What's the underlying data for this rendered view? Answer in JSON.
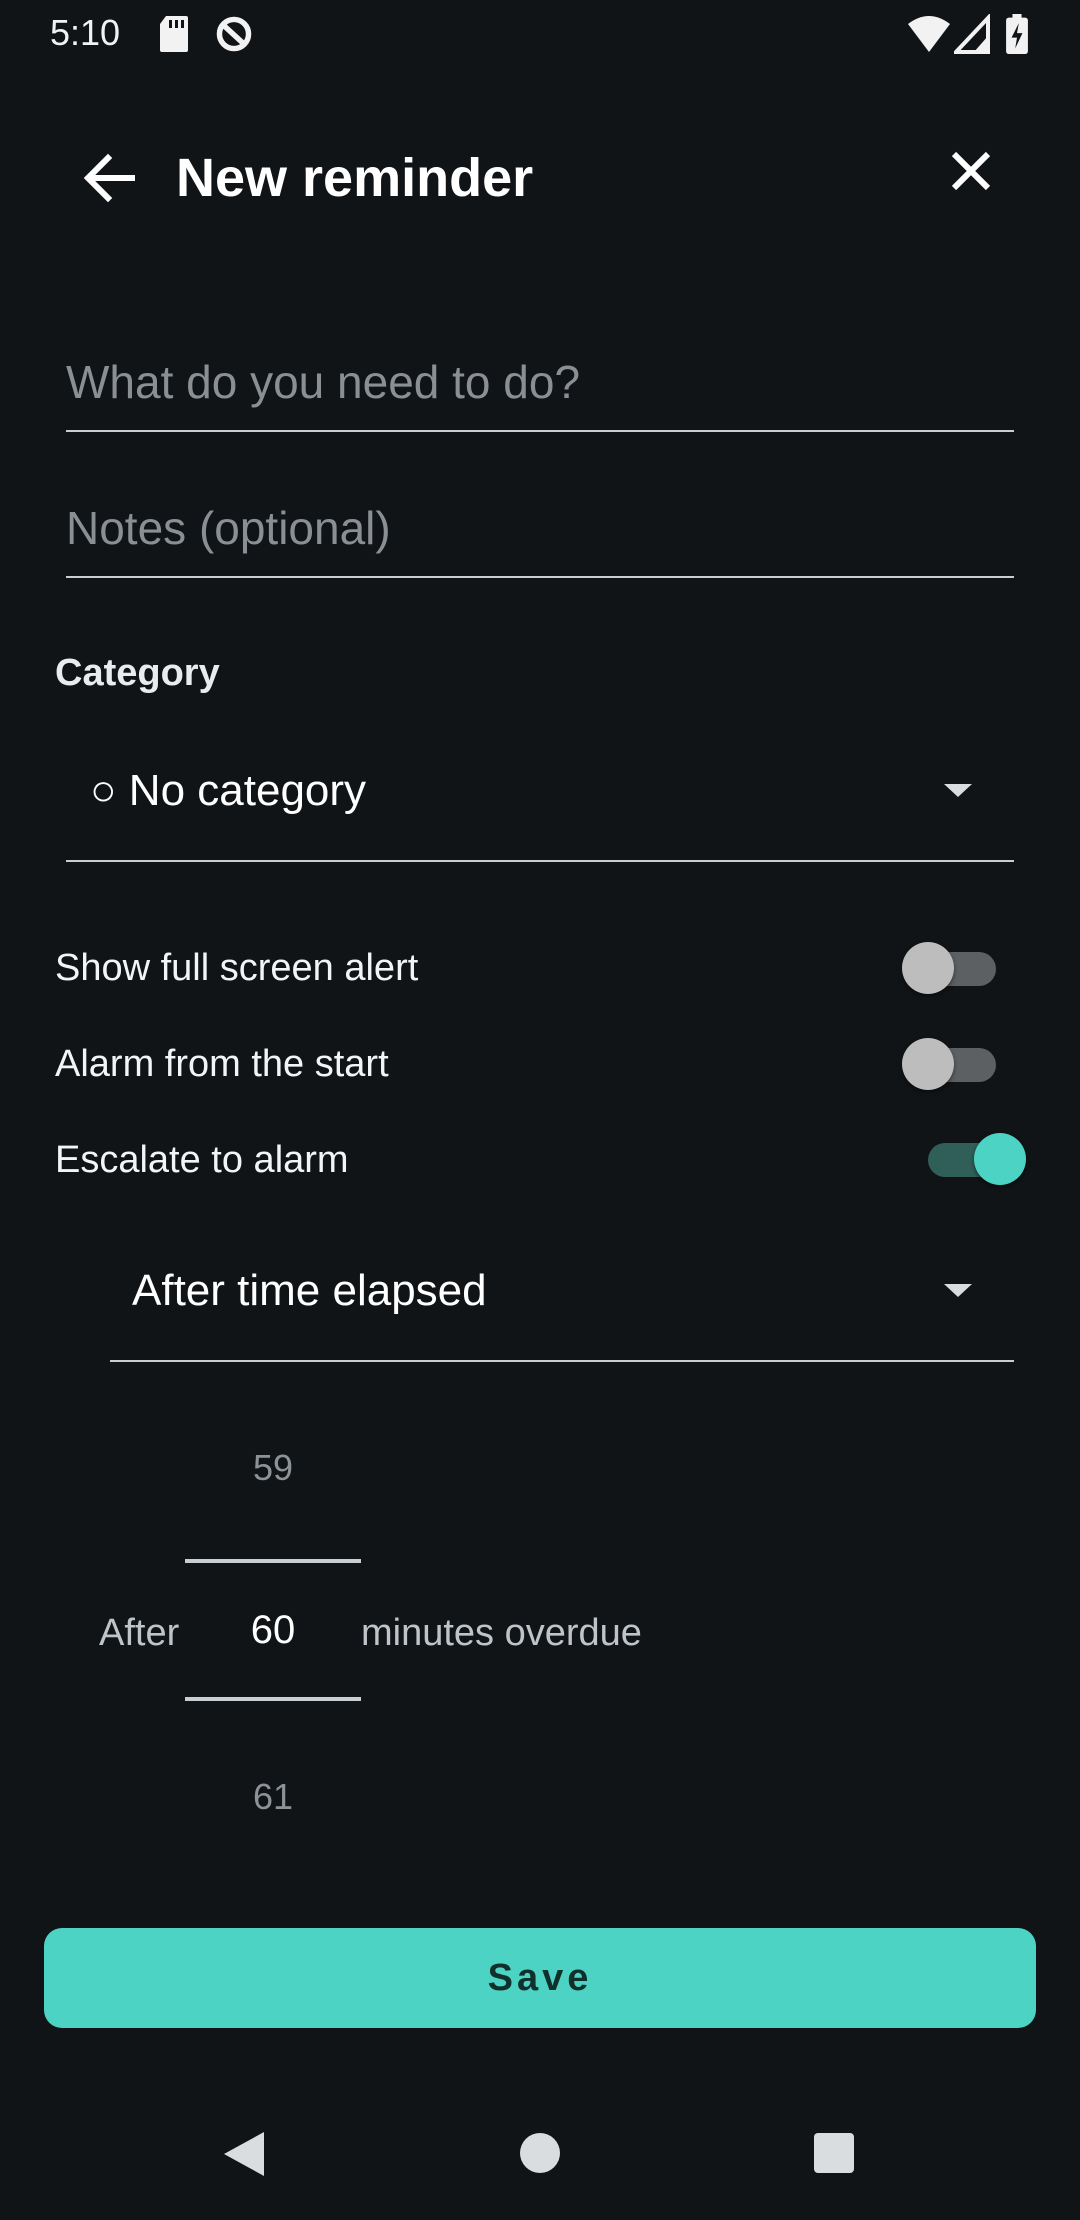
{
  "status_bar": {
    "time": "5:10",
    "left_icons": [
      "sd-card-icon",
      "data-saver-icon"
    ],
    "right_icons": [
      "wifi-icon",
      "cell-signal-icon",
      "battery-charging-icon"
    ]
  },
  "app_bar": {
    "title": "New reminder",
    "back_icon": "arrow-left-icon",
    "close_icon": "close-icon"
  },
  "form": {
    "task_placeholder": "What do you need to do?",
    "task_value": "",
    "notes_placeholder": "Notes (optional)",
    "notes_value": "",
    "category_label": "Category",
    "category_selected": "○ No category",
    "switches": [
      {
        "label": "Show full screen alert",
        "on": false
      },
      {
        "label": "Alarm from the start",
        "on": false
      },
      {
        "label": "Escalate to alarm",
        "on": true
      }
    ],
    "escalation_mode_selected": "After time elapsed",
    "picker": {
      "prefix": "After",
      "suffix": "minutes overdue",
      "previous": "59",
      "selected": "60",
      "next": "61"
    }
  },
  "save_button": {
    "label": "Save"
  },
  "colors": {
    "background": "#111417",
    "accent": "#4dd3c3",
    "accent_track": "#2f5f58",
    "text": "#ffffff",
    "hint": "#8a8f94"
  },
  "nav_bar": {
    "icons": [
      "nav-back-icon",
      "nav-home-icon",
      "nav-recents-icon"
    ]
  }
}
